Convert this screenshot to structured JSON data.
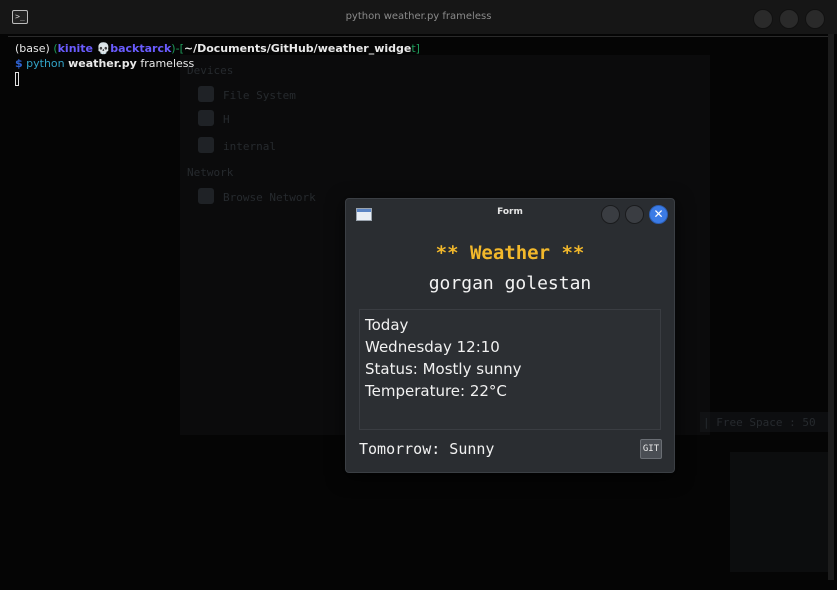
{
  "terminal": {
    "title": "python weather.py frameless",
    "prompt": {
      "env": "(base)",
      "user_open": "(",
      "user": "kinite",
      "skull": "💀",
      "host": "backtarck",
      "user_close": ")",
      "dash": "-[",
      "path": "~/Documents/GitHub/weather_widge",
      "path_close": "t]"
    },
    "command": {
      "dollar": "$",
      "program": "python",
      "script": "weather.py",
      "arg": "frameless"
    }
  },
  "background_file_manager": {
    "section_devices": "Devices",
    "item_file_system": "File System",
    "item_h": "H",
    "item_internal": "internal",
    "section_network": "Network",
    "item_browse_network": "Browse Network",
    "free_space": "| Free Space : 50"
  },
  "form": {
    "title": "Form",
    "close_glyph": "✕",
    "heading": "** Weather **",
    "city": "gorgan golestan",
    "today": {
      "label": "Today",
      "datetime": "Wednesday 12:10",
      "status": "Status: Mostly sunny",
      "temperature": "Temperature: 22°C"
    },
    "tomorrow": "Tomorrow: Sunny",
    "git_label": "GIT"
  },
  "colors": {
    "heading": "#f2b82b",
    "close_button": "#3b7be6",
    "prompt_user": "#6a5cff",
    "prompt_path": "#ffffff",
    "command": "#32a3c7"
  }
}
